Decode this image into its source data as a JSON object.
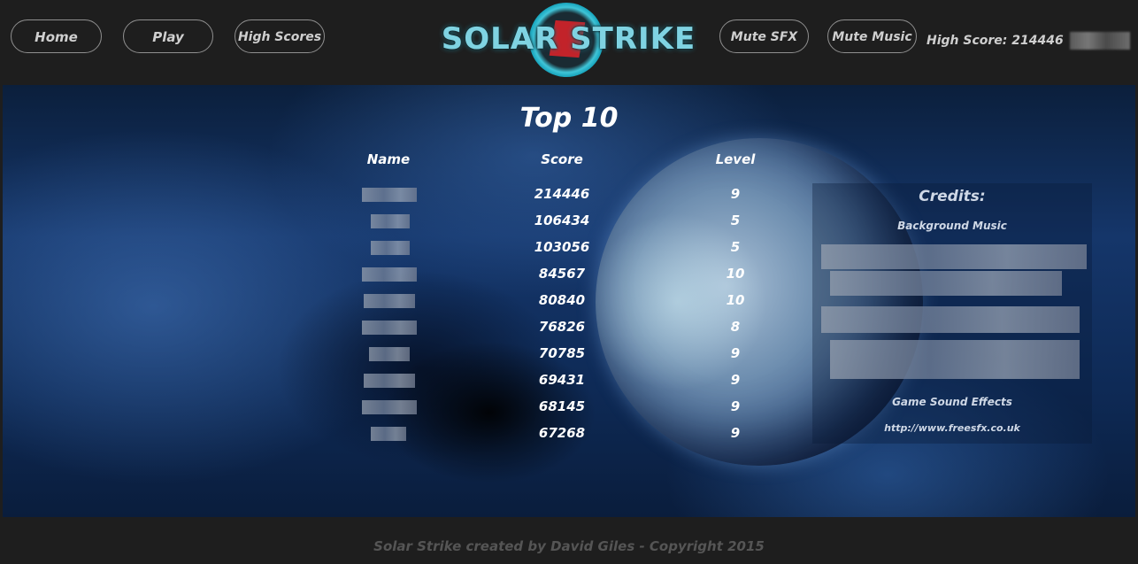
{
  "nav": {
    "home": "Home",
    "play": "Play",
    "high_scores": "High Scores",
    "mute_sfx": "Mute SFX",
    "mute_music": "Mute Music",
    "high_score_label": "High Score: 214446"
  },
  "logo": {
    "text": "SOLAR STRIKE"
  },
  "leaderboard": {
    "title": "Top 10",
    "headers": {
      "name": "Name",
      "score": "Score",
      "level": "Level"
    },
    "rows": [
      {
        "score": "214446",
        "level": "9"
      },
      {
        "score": "106434",
        "level": "5"
      },
      {
        "score": "103056",
        "level": "5"
      },
      {
        "score": "84567",
        "level": "10"
      },
      {
        "score": "80840",
        "level": "10"
      },
      {
        "score": "76826",
        "level": "8"
      },
      {
        "score": "70785",
        "level": "9"
      },
      {
        "score": "69431",
        "level": "9"
      },
      {
        "score": "68145",
        "level": "9"
      },
      {
        "score": "67268",
        "level": "9"
      }
    ]
  },
  "credits": {
    "title": "Credits:",
    "music_heading": "Background Music",
    "sfx_heading": "Game Sound Effects",
    "sfx_link": "http://www.freesfx.co.uk"
  },
  "footer": {
    "text": "Solar Strike created by David Giles - Copyright 2015"
  }
}
